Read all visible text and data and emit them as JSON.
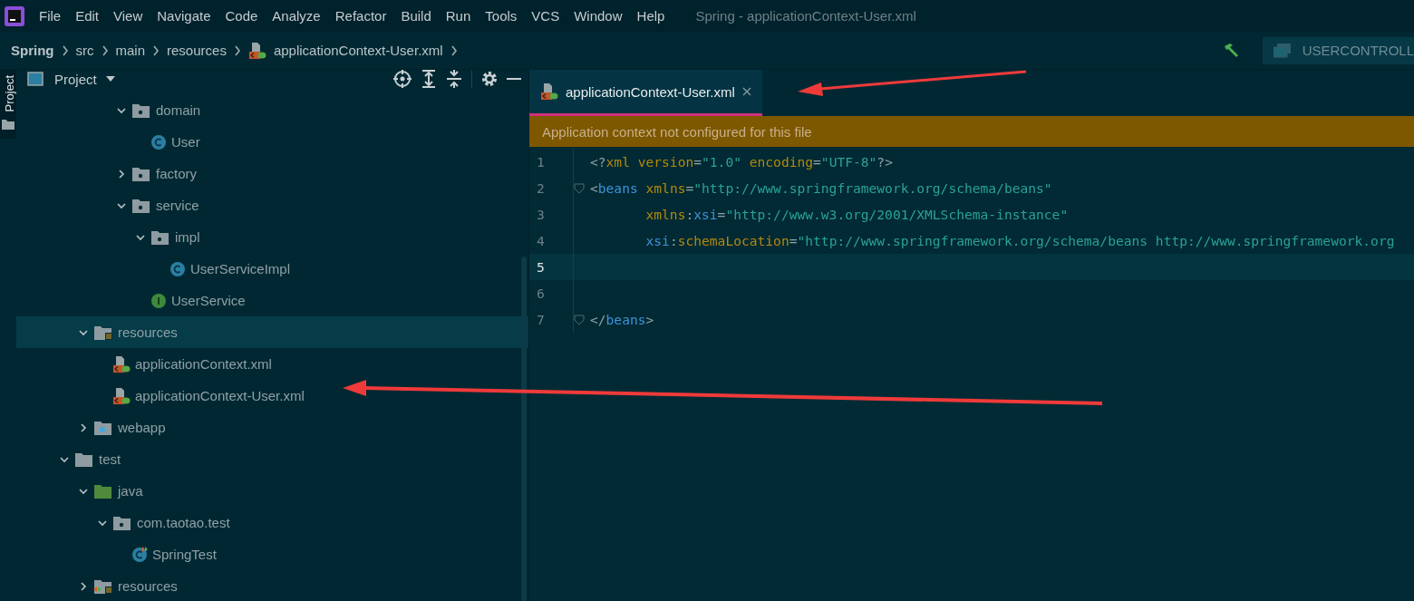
{
  "menu": [
    "File",
    "Edit",
    "View",
    "Navigate",
    "Code",
    "Analyze",
    "Refactor",
    "Build",
    "Run",
    "Tools",
    "VCS",
    "Window",
    "Help"
  ],
  "window": {
    "title": "Spring - applicationContext-User.xml"
  },
  "breadcrumb": [
    {
      "label": "Spring",
      "kind": "project"
    },
    {
      "label": "src",
      "kind": "dir"
    },
    {
      "label": "main",
      "kind": "dir"
    },
    {
      "label": "resources",
      "kind": "dir"
    },
    {
      "label": "applicationContext-User.xml",
      "kind": "xml"
    }
  ],
  "run_config": {
    "label": "USERCONTROLL"
  },
  "side_strip": {
    "label": "Project"
  },
  "project_panel": {
    "title": "Project"
  },
  "tree": [
    {
      "children": [
        {
          "children": [
            {
              "children": [
                {
                  "label": "domain",
                  "kind": "package",
                  "expanded": true,
                  "selected": false,
                  "children": [
                    {
                      "label": "User",
                      "kind": "class",
                      "selected": false
                    }
                  ]
                },
                {
                  "label": "factory",
                  "kind": "package",
                  "expanded": false,
                  "selected": false
                },
                {
                  "label": "service",
                  "kind": "package",
                  "expanded": true,
                  "selected": false,
                  "children": [
                    {
                      "label": "impl",
                      "kind": "package",
                      "expanded": true,
                      "selected": false,
                      "children": [
                        {
                          "label": "UserServiceImpl",
                          "kind": "class",
                          "selected": false
                        }
                      ]
                    },
                    {
                      "label": "UserService",
                      "kind": "interface",
                      "selected": false
                    }
                  ]
                }
              ]
            }
          ]
        },
        {
          "label": "resources",
          "kind": "resources",
          "expanded": true,
          "selected": true,
          "children": [
            {
              "label": "applicationContext.xml",
              "kind": "spring-xml",
              "selected": false
            },
            {
              "label": "applicationContext-User.xml",
              "kind": "spring-xml",
              "selected": false
            }
          ]
        },
        {
          "label": "webapp",
          "kind": "web",
          "expanded": false,
          "selected": false
        }
      ]
    },
    {
      "label": "test",
      "kind": "folder",
      "expanded": true,
      "selected": false,
      "children": [
        {
          "label": "java",
          "kind": "test-root",
          "expanded": true,
          "selected": false,
          "children": [
            {
              "label": "com.taotao.test",
              "kind": "package",
              "expanded": true,
              "selected": false,
              "children": [
                {
                  "label": "SpringTest",
                  "kind": "test-class",
                  "selected": false
                }
              ]
            }
          ]
        },
        {
          "label": "resources",
          "kind": "test-resources",
          "expanded": false,
          "selected": false
        }
      ]
    }
  ],
  "editor_tabs": [
    {
      "label": "applicationContext-User.xml",
      "selected": true
    }
  ],
  "banner": "Application context not configured for this file",
  "code": [
    {
      "number": "1",
      "current": false,
      "fold": false,
      "tokens": [
        {
          "text": "<?",
          "kind": "punct"
        },
        {
          "text": "xml version",
          "kind": "attr"
        },
        {
          "text": "=",
          "kind": "punct"
        },
        {
          "text": "\"1.0\"",
          "kind": "value"
        },
        {
          "text": " encoding",
          "kind": "attr"
        },
        {
          "text": "=",
          "kind": "punct"
        },
        {
          "text": "\"UTF-8\"",
          "kind": "value"
        },
        {
          "text": "?>",
          "kind": "punct"
        }
      ]
    },
    {
      "number": "2",
      "current": false,
      "fold": true,
      "tokens": [
        {
          "text": "<",
          "kind": "punct"
        },
        {
          "text": "beans",
          "kind": "tag"
        },
        {
          "text": " xmlns",
          "kind": "attr"
        },
        {
          "text": "=",
          "kind": "punct"
        },
        {
          "text": "\"http://www.springframework.org/schema/beans\"",
          "kind": "value"
        }
      ]
    },
    {
      "number": "3",
      "current": false,
      "fold": false,
      "tokens": [
        {
          "text": "       xmlns",
          "kind": "attr"
        },
        {
          "text": ":",
          "kind": "punct"
        },
        {
          "text": "xsi",
          "kind": "tag"
        },
        {
          "text": "=",
          "kind": "punct"
        },
        {
          "text": "\"http://www.w3.org/2001/XMLSchema-instance\"",
          "kind": "value"
        }
      ]
    },
    {
      "number": "4",
      "current": false,
      "fold": false,
      "tokens": [
        {
          "text": "       xsi",
          "kind": "tag"
        },
        {
          "text": ":",
          "kind": "punct"
        },
        {
          "text": "schemaLocation",
          "kind": "attr"
        },
        {
          "text": "=",
          "kind": "punct"
        },
        {
          "text": "\"http://www.springframework.org/schema/beans http://www.springframework.org",
          "kind": "value"
        }
      ]
    },
    {
      "number": "5",
      "current": true,
      "fold": false
    },
    {
      "number": "6",
      "current": false,
      "fold": false
    },
    {
      "number": "7",
      "current": false,
      "fold": true,
      "tokens": [
        {
          "text": "</",
          "kind": "punct"
        },
        {
          "text": "beans",
          "kind": "tag"
        },
        {
          "text": ">",
          "kind": "punct"
        }
      ]
    }
  ]
}
